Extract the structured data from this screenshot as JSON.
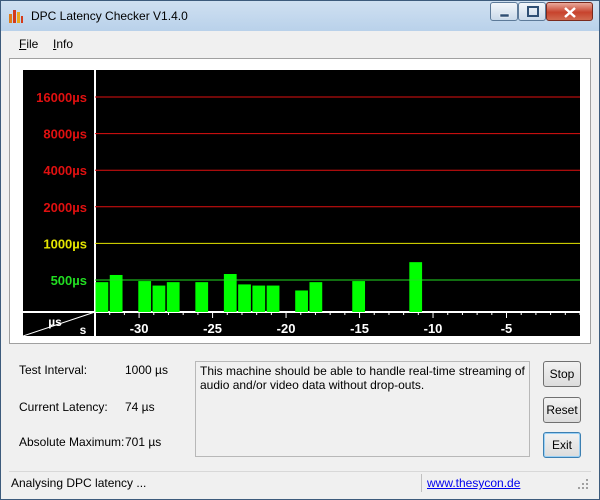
{
  "window": {
    "title": "DPC Latency Checker V1.4.0"
  },
  "menu": {
    "items": [
      "File",
      "Info"
    ]
  },
  "chart_data": {
    "type": "bar",
    "y_tick_labels": [
      {
        "label": "16000µs",
        "value": 16000,
        "color": "#e01010"
      },
      {
        "label": "8000µs",
        "value": 8000,
        "color": "#e01010"
      },
      {
        "label": "4000µs",
        "value": 4000,
        "color": "#e01010"
      },
      {
        "label": "2000µs",
        "value": 2000,
        "color": "#e01010"
      },
      {
        "label": "1000µs",
        "value": 1000,
        "color": "#e6e600"
      },
      {
        "label": "500µs",
        "value": 500,
        "color": "#22dd22"
      }
    ],
    "xlabel_unit": "s",
    "ylabel_unit": "µs",
    "x_ticks": [
      -30,
      -25,
      -20,
      -15,
      -10,
      -5
    ],
    "x_tick_labels": [
      "-30",
      "-25",
      "-20",
      "-15",
      "-10",
      "-5"
    ],
    "x_range": [
      -33,
      0
    ],
    "y_scale": "log",
    "bar_color": "#00ff00",
    "values": [
      480,
      550,
      110,
      490,
      450,
      480,
      150,
      480,
      230,
      560,
      460,
      450,
      450,
      200,
      410,
      480,
      190,
      110,
      490,
      110,
      110,
      110,
      701,
      110,
      170,
      150,
      140,
      130,
      130,
      130,
      150,
      130,
      150,
      160
    ]
  },
  "info": {
    "test_interval_label": "Test Interval:",
    "test_interval_value": "1000 µs",
    "current_latency_label": "Current Latency:",
    "current_latency_value": "74 µs",
    "absolute_maximum_label": "Absolute Maximum:",
    "absolute_maximum_value": "701 µs"
  },
  "message": "This machine should be able to handle real-time streaming of audio and/or video data without drop-outs.",
  "buttons": {
    "stop": "Stop",
    "reset": "Reset",
    "exit": "Exit"
  },
  "status": {
    "text": "Analysing DPC latency ...",
    "link": "www.thesycon.de"
  }
}
